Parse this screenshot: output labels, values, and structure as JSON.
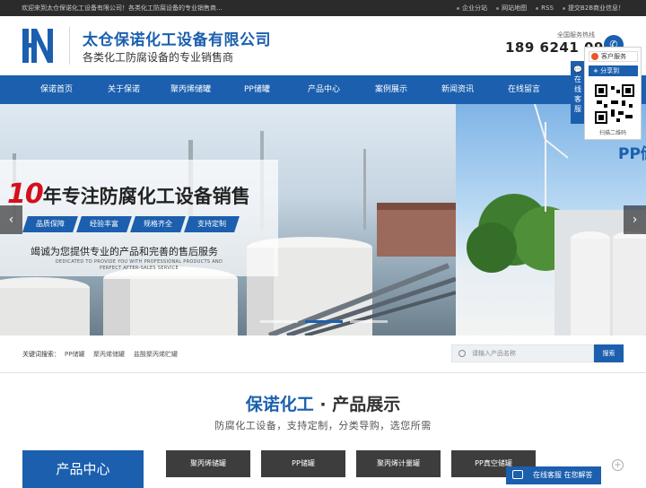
{
  "topbar": {
    "welcome": "欢迎来到太仓保诺化工设备有限公司！各类化工防腐设备的专业销售商...",
    "links": [
      "企业分站",
      "网站地图",
      "RSS",
      "提交B2B商业信息！"
    ]
  },
  "header": {
    "company_name": "太仓保诺化工设备有限公司",
    "slogan": "各类化工防腐设备的专业销售商",
    "hotline_label": "全国服务热线",
    "hotline_number": "189 6241 0987"
  },
  "nav": [
    {
      "label": "保诺首页"
    },
    {
      "label": "关于保诺"
    },
    {
      "label": "聚丙烯储罐"
    },
    {
      "label": "PP储罐"
    },
    {
      "label": "产品中心"
    },
    {
      "label": "案例展示"
    },
    {
      "label": "新闻资讯"
    },
    {
      "label": "在线留言"
    }
  ],
  "banner": {
    "title_number": "10",
    "title_text": "年专注防腐化工设备销售",
    "features": [
      "品质保障",
      "经验丰富",
      "规格齐全",
      "支持定制"
    ],
    "subtitle": "竭诚为您提供专业的产品和完善的售后服务",
    "subtitle_en": "DEDICATED TO PROVIDE YOU WITH PROFESSIONAL PRODUCTS AND PERFECT AFTER-SALES SERVICE",
    "side_text": "PP储",
    "prev_arrow": "‹",
    "next_arrow": "›"
  },
  "float_panel": {
    "tab_text": "在线客服",
    "service_label": "客户服务",
    "share_label": "分享到",
    "share_plus": "+",
    "qr_label": "扫描二维码"
  },
  "search": {
    "keywords_label": "关键词搜索：",
    "keywords": [
      "PP储罐",
      "聚丙烯储罐",
      "盐酸聚丙烯贮罐"
    ],
    "placeholder": "请输入产品名称",
    "button": "搜索"
  },
  "products": {
    "title_blue": "保诺化工",
    "title_sep": " · ",
    "title_rest": "产品展示",
    "subtitle": "防腐化工设备，支持定制，分类导购，选您所需",
    "category_head": "产品中心",
    "categories": [
      "聚丙烯储罐",
      "PP储罐",
      "聚丙烯计量罐",
      "PP真空储罐"
    ]
  },
  "online_service": {
    "label": "在线客服 在您解答"
  },
  "colors": {
    "brand_blue": "#1b5fae",
    "topbar": "#2b2b2b",
    "accent_red": "#d4101b"
  }
}
